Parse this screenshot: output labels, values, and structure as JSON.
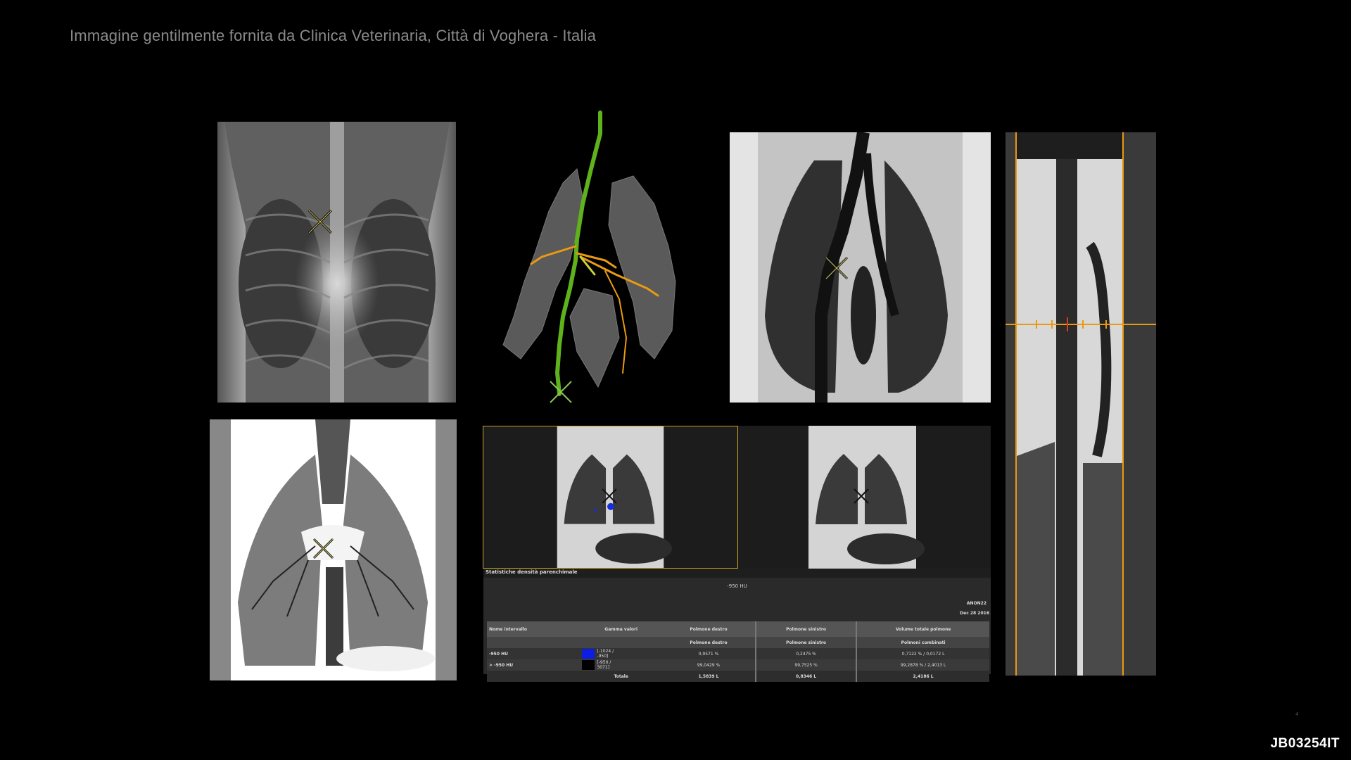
{
  "credit": "Immagine gentilmente fornita da Clinica Veterinaria, Città di Voghera - Italia",
  "code": "JB03254IT",
  "page_dot": "4",
  "stats": {
    "title": "Statistiche densità parenchimale",
    "threshold": "-950 HU",
    "patient": "ANON22",
    "date": "Dec 28 2016",
    "headers": {
      "interval": "Nome intervallo",
      "range": "Gamma valori",
      "right": "Polmone destro",
      "left": "Polmone sinistro",
      "total": "Volume totale polmone"
    },
    "subheaders": {
      "right": "Polmone destro",
      "left": "Polmone sinistro",
      "total": "Polmoni combinati"
    },
    "rows": [
      {
        "name": "-950 HU",
        "range_a": "[-1024 /",
        "range_b": "-950]",
        "color": "#0a1ee6",
        "right": "0,9571 %",
        "left": "0,2475 %",
        "total": "0,7122 % / 0,0172 L"
      },
      {
        "name": "> -950 HU",
        "range_a": "[-950 /",
        "range_b": "3071]",
        "color": "#000000",
        "right": "99,0429 %",
        "left": "99,7525 %",
        "total": "99,2878 % / 2,4013 L"
      }
    ],
    "totals": {
      "label": "Totale",
      "right": "1,5839 L",
      "left": "0,8346 L",
      "total": "2,4186 L"
    }
  },
  "colors": {
    "background": "#000000",
    "airway_green": "#5fb21c",
    "airway_orange": "#e89a12",
    "frame_yellow": "#c9a21a",
    "highlight_blue": "#1430d8"
  },
  "icons": [
    "crosshair-marker-icon"
  ]
}
